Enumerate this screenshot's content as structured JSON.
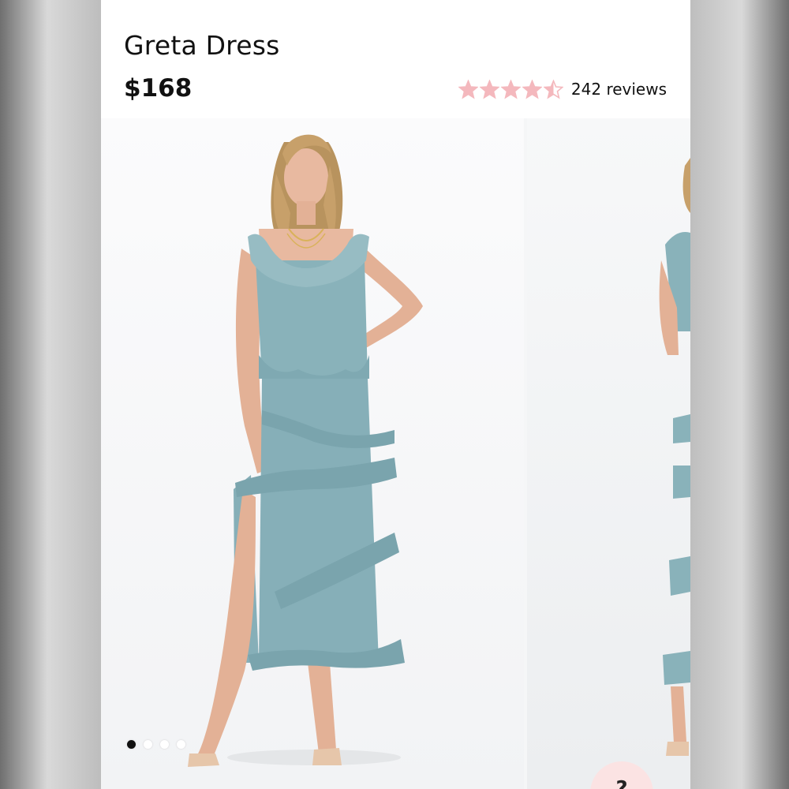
{
  "product": {
    "title": "Greta Dress",
    "price": "$168"
  },
  "rating": {
    "value": 4.5,
    "max": 5,
    "star_color": "#f4b8bd",
    "review_count_text": "242 reviews"
  },
  "gallery": {
    "dress_color": "#89b2ba",
    "current_index": 0,
    "total_images": 4
  },
  "help_button": {
    "icon": "question-mark-icon",
    "glyph": "?",
    "color": "#fbe3e3"
  }
}
